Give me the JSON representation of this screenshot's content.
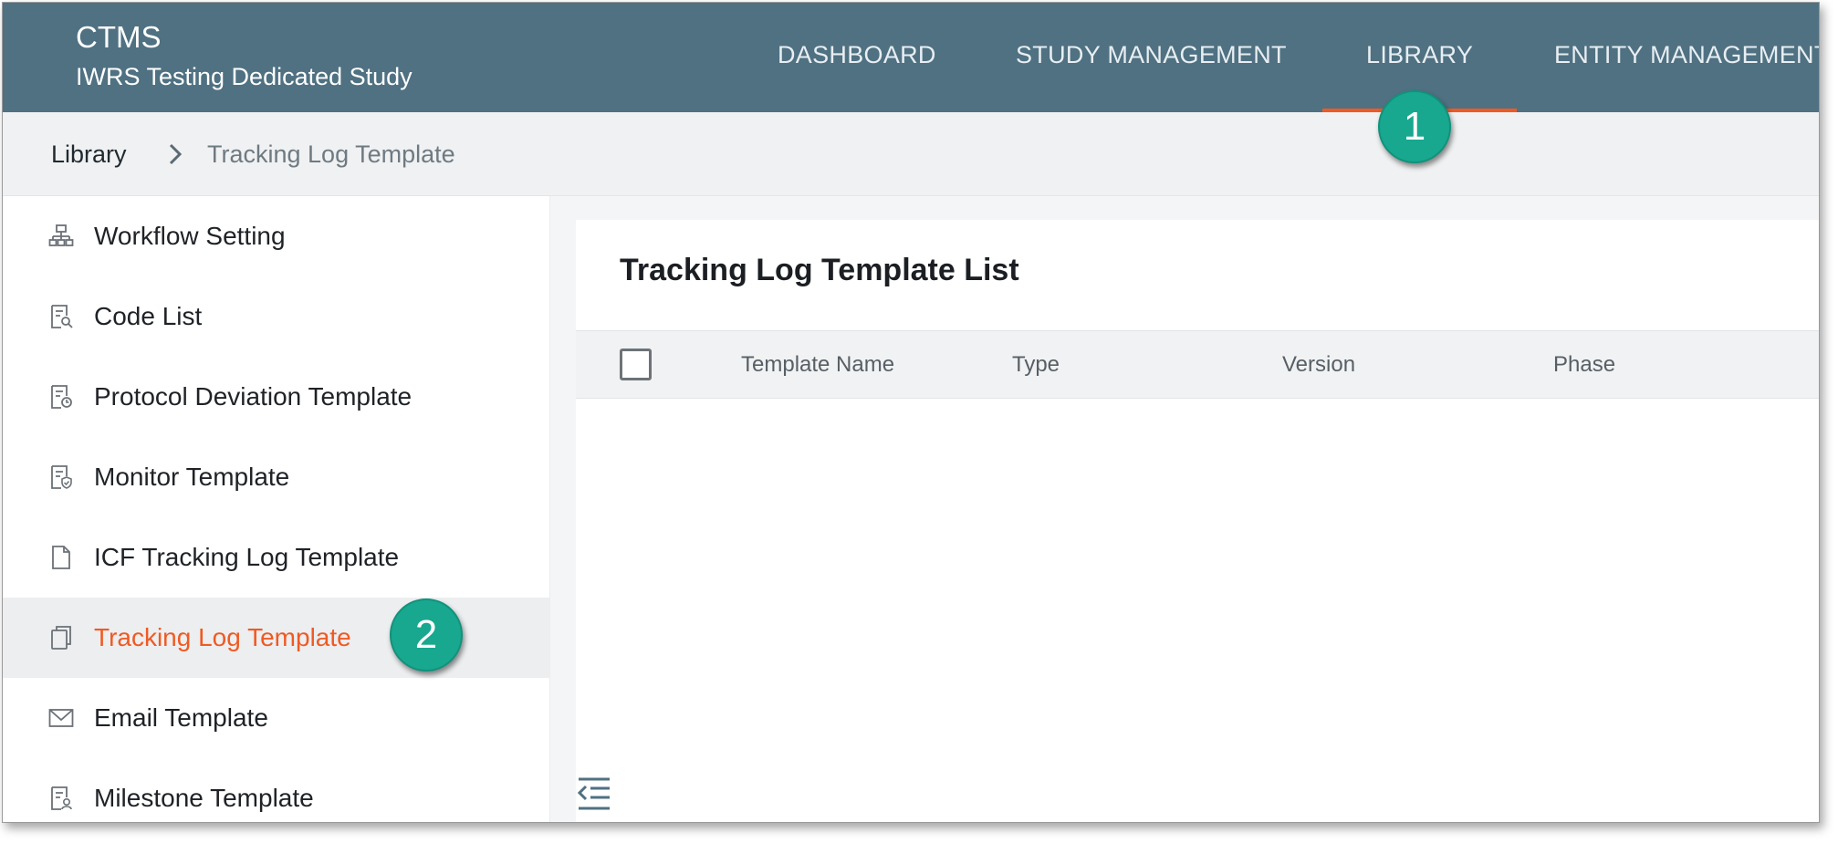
{
  "app": {
    "title": "CTMS",
    "study": "IWRS Testing Dedicated Study"
  },
  "nav": {
    "items": [
      {
        "label": "DASHBOARD"
      },
      {
        "label": "STUDY MANAGEMENT"
      },
      {
        "label": "LIBRARY",
        "active": true
      },
      {
        "label": "ENTITY MANAGEMENT"
      }
    ]
  },
  "breadcrumb": {
    "root": "Library",
    "current": "Tracking Log Template"
  },
  "sidebar": {
    "items": [
      {
        "label": "Workflow Setting",
        "icon": "workflow-icon"
      },
      {
        "label": "Code List",
        "icon": "code-list-icon"
      },
      {
        "label": "Protocol Deviation Template",
        "icon": "protocol-deviation-icon"
      },
      {
        "label": "Monitor Template",
        "icon": "monitor-template-icon"
      },
      {
        "label": "ICF Tracking Log Template",
        "icon": "file-icon"
      },
      {
        "label": "Tracking Log Template",
        "icon": "copy-document-icon",
        "active": true
      },
      {
        "label": "Email Template",
        "icon": "envelope-icon"
      },
      {
        "label": "Milestone Template",
        "icon": "milestone-template-icon"
      }
    ]
  },
  "main": {
    "title": "Tracking Log Template List",
    "columns": [
      "Template Name",
      "Type",
      "Version",
      "Phase"
    ]
  },
  "callouts": [
    "1",
    "2"
  ],
  "colors": {
    "header": "#4f7182",
    "accent": "#f05a22",
    "callout": "#17a88f"
  }
}
